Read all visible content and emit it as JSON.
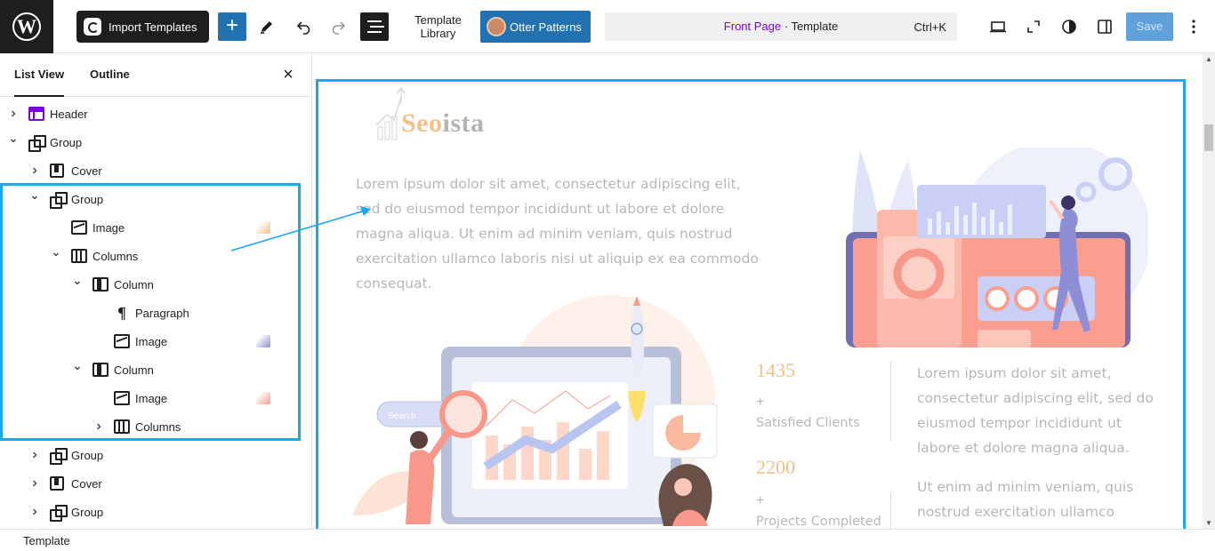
{
  "toolbar": {
    "import_label": "Import Templates",
    "add_label": "+",
    "template_library_line1": "Template",
    "template_library_line2": "Library",
    "otter_label": "Otter Patterns",
    "command_page": "Front Page",
    "command_sep": " · ",
    "command_type": "Template",
    "command_shortcut": "Ctrl+K",
    "save_label": "Save"
  },
  "sidebar": {
    "tabs": [
      {
        "label": "List View",
        "active": true
      },
      {
        "label": "Outline",
        "active": false
      }
    ],
    "close_label": "×",
    "tree": [
      {
        "label": "Header",
        "icon": "header-icon",
        "depth": 0,
        "chevron": "right"
      },
      {
        "label": "Group",
        "icon": "group-icon",
        "depth": 0,
        "chevron": "down"
      },
      {
        "label": "Cover",
        "icon": "cover-icon",
        "depth": 1,
        "chevron": "right"
      },
      {
        "label": "Group",
        "icon": "group-icon",
        "depth": 1,
        "chevron": "down"
      },
      {
        "label": "Image",
        "icon": "image-icon",
        "depth": 2,
        "chevron": "",
        "thumb": true
      },
      {
        "label": "Columns",
        "icon": "columns-icon",
        "depth": 2,
        "chevron": "down"
      },
      {
        "label": "Column",
        "icon": "column-icon",
        "depth": 3,
        "chevron": "down"
      },
      {
        "label": "Paragraph",
        "icon": "paragraph-icon",
        "depth": 4,
        "chevron": ""
      },
      {
        "label": "Image",
        "icon": "image-icon",
        "depth": 4,
        "chevron": "",
        "thumb": true
      },
      {
        "label": "Column",
        "icon": "column-icon",
        "depth": 3,
        "chevron": "down"
      },
      {
        "label": "Image",
        "icon": "image-icon",
        "depth": 4,
        "chevron": "",
        "thumb": true
      },
      {
        "label": "Columns",
        "icon": "columns-icon",
        "depth": 4,
        "chevron": "right"
      },
      {
        "label": "Group",
        "icon": "group-icon",
        "depth": 1,
        "chevron": "right"
      },
      {
        "label": "Cover",
        "icon": "cover-icon",
        "depth": 1,
        "chevron": "right"
      },
      {
        "label": "Group",
        "icon": "group-icon",
        "depth": 1,
        "chevron": "right"
      }
    ]
  },
  "canvas": {
    "logo_part1": "Seo",
    "logo_part2": "ista",
    "intro_text": "Lorem ipsum dolor sit amet, consectetur adipiscing elit, sed do eiusmod tempor incididunt ut labore et dolore magna aliqua. Ut enim ad minim veniam, quis nostrud exercitation ullamco laboris nisi ut aliquip ex ea commodo consequat.",
    "search_label": "Search",
    "stats": [
      {
        "number": "1435",
        "plus": "+",
        "label": "Satisfied Clients"
      },
      {
        "number": "2200",
        "plus": "+",
        "label": "Projects Completed"
      }
    ],
    "side_text_1": "Lorem ipsum dolor sit amet, consectetur adipiscing elit, sed do eiusmod tempor incididunt ut labore et dolore magna aliqua.",
    "side_text_2": "Ut enim ad minim veniam, quis nostrud exercitation ullamco"
  },
  "footer": {
    "breadcrumb": "Template"
  },
  "colors": {
    "accent": "#2271b1",
    "selection": "#1ea7ec",
    "brand_dark": "#1e1e1e",
    "site_accent": "#f2c089",
    "page_link": "#7a00df"
  }
}
